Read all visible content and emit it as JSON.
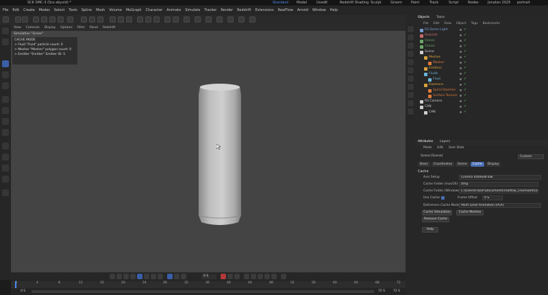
{
  "window": {
    "title": "SCK SMC-3 (Scs abyvid) *",
    "workspaces": [
      "Standard",
      "Model",
      "Uvedit",
      "Redshift Shading",
      "Sculpt",
      "Groom",
      "Paint",
      "Track",
      "Script",
      "Nodes",
      "Jonatan 2025",
      "portrait"
    ]
  },
  "menubar": [
    "File",
    "Edit",
    "Create",
    "Modes",
    "Select",
    "Tools",
    "Spline",
    "Mesh",
    "Volume",
    "MoGraph",
    "Character",
    "Animate",
    "Simulate",
    "Tracker",
    "Render",
    "Redshift",
    "Extensions",
    "RealFlow",
    "Arnold",
    "Window",
    "Help"
  ],
  "viewport": {
    "menu": [
      "View",
      "Cameras",
      "Display",
      "Options",
      "Filter",
      "Panel",
      "Redshift"
    ],
    "label": "Simulation \"Scene\"",
    "overlay": [
      "CACHE MODE",
      "> Fluid \"Fluid\" particle count: 0",
      "> Mesher \"Mesher\" polygon count: 0",
      "> Emitter \"Emitter\" Emitter ID: 5"
    ]
  },
  "objects": {
    "tabs": [
      "Objects",
      "Takes"
    ],
    "menu": [
      "File",
      "Edit",
      "View",
      "Object",
      "Tags",
      "Bookmarks"
    ],
    "rows": [
      {
        "name": "RS Dome Light",
        "color": "#7a9cd6",
        "indent": 0
      },
      {
        "name": "Redshift",
        "color": "#c96a6a",
        "indent": 0
      },
      {
        "name": "Cloner",
        "color": "#6aa86a",
        "indent": 0
      },
      {
        "name": "Cloner",
        "color": "#6aa86a",
        "indent": 0
      },
      {
        "name": "Scene",
        "color": "#cfcfcf",
        "indent": 0
      },
      {
        "name": "Meshes",
        "color": "#d9a33b",
        "indent": 1
      },
      {
        "name": "Mesher",
        "color": "#e07b39",
        "indent": 2
      },
      {
        "name": "Emitters",
        "color": "#d9a33b",
        "indent": 1
      },
      {
        "name": "Fluids",
        "color": "#6ab8e0",
        "indent": 1
      },
      {
        "name": "Fluid",
        "color": "#6ab8e0",
        "indent": 2
      },
      {
        "name": "Daemons",
        "color": "#d9a33b",
        "indent": 1
      },
      {
        "name": "Spiral Daemon",
        "color": "#e07b39",
        "indent": 2
      },
      {
        "name": "Surface Tension",
        "color": "#e07b39",
        "indent": 2
      },
      {
        "name": "RS Camera",
        "color": "#cfcfcf",
        "indent": 0
      },
      {
        "name": "CAN",
        "color": "#cfcfcf",
        "indent": 0
      },
      {
        "name": "CAN",
        "color": "#cfcfcf",
        "indent": 1
      }
    ]
  },
  "attributes": {
    "tabs": [
      "Attributes",
      "Layers"
    ],
    "menu": [
      "Mode",
      "Edit",
      "User Data"
    ],
    "scene_label": "Scene [Scene]",
    "preset": "Custom",
    "subtabs": [
      "Basic",
      "Coordinates",
      "Scene",
      "Cache",
      "Display"
    ],
    "active_subtab": "Cache",
    "section": "Cache",
    "fields": {
      "axis_label": "Axis Setup",
      "axis_value": "Cinema 4D/RealFlow",
      "mac_label": "Cache Folder (macOS)",
      "mac_value": "/tmp",
      "win_label": "Cache Folder (Windows)",
      "win_value": "C:\\Users\\Fraser\\Documents\\realflow_cinema4d\\cache",
      "use_label": "Use Cache",
      "offset_label": "Frame Offset",
      "offset_value": "0 S",
      "deformer_label": "Deformers Cache Mode",
      "deformer_value": "Point Level Animation (PLA)"
    },
    "buttons": {
      "cache_sim": "Cache Simulation",
      "cache_meshes": "Cache Meshes",
      "remove": "Remove Cache",
      "help": "Help"
    }
  },
  "timeline": {
    "current": "0 S",
    "ticks": [
      "0",
      "4",
      "8",
      "12",
      "16",
      "20",
      "24",
      "28",
      "32",
      "36",
      "40",
      "44",
      "48",
      "52",
      "56",
      "60",
      "64",
      "68",
      "72"
    ],
    "start": "0 S",
    "end": "72 S",
    "end2": "72 S"
  }
}
